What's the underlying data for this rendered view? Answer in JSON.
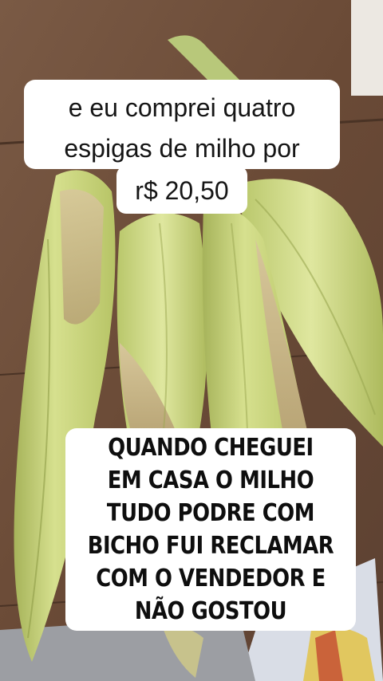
{
  "caption_top": {
    "line1": "e eu comprei quatro",
    "line2": "espigas de milho por",
    "line3": "r$ 20,50"
  },
  "caption_bottom": {
    "line1": "QUANDO CHEGUEI",
    "line2": "EM CASA O MILHO",
    "line3": "TUDO PODRE COM",
    "line4": "BICHO FUI RECLAMAR",
    "line5": "COM O VENDEDOR E",
    "line6": "NÃO GOSTOU"
  },
  "colors": {
    "table_wood": "#6b4a35",
    "husk_green": "#c9d67a",
    "caption_bg": "#ffffff"
  }
}
